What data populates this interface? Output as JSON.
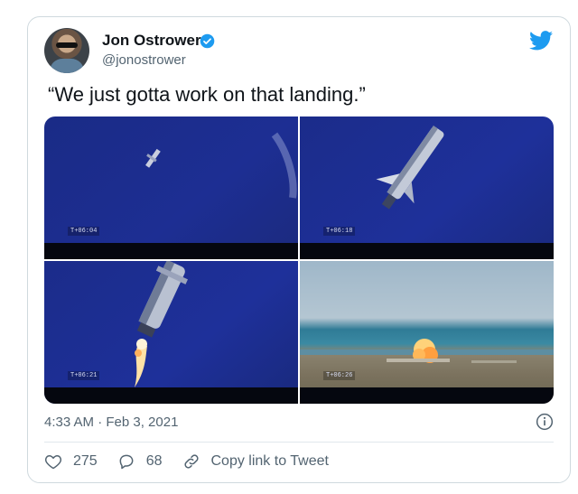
{
  "author": {
    "name": "Jon Ostrower",
    "handle": "@jonostrower"
  },
  "tweet": {
    "text": "“We just gotta work on that landing.”"
  },
  "media": {
    "frames": [
      {
        "timestamp": "T+06:04"
      },
      {
        "timestamp": "T+06:18"
      },
      {
        "timestamp": "T+06:21"
      },
      {
        "timestamp": "T+06:26"
      }
    ]
  },
  "meta": {
    "posted": "4:33 AM · Feb 3, 2021"
  },
  "actions": {
    "likes": "275",
    "replies": "68",
    "copy_link": "Copy link to Tweet"
  },
  "icons": {
    "verified": "verified-badge-icon",
    "brand": "twitter-bird-icon",
    "info": "info-icon",
    "like": "heart-icon",
    "reply": "reply-icon",
    "link": "link-icon"
  },
  "colors": {
    "brand": "#1d9bf0",
    "text": "#0f1419",
    "muted": "#536471",
    "border": "#cfd9de"
  }
}
